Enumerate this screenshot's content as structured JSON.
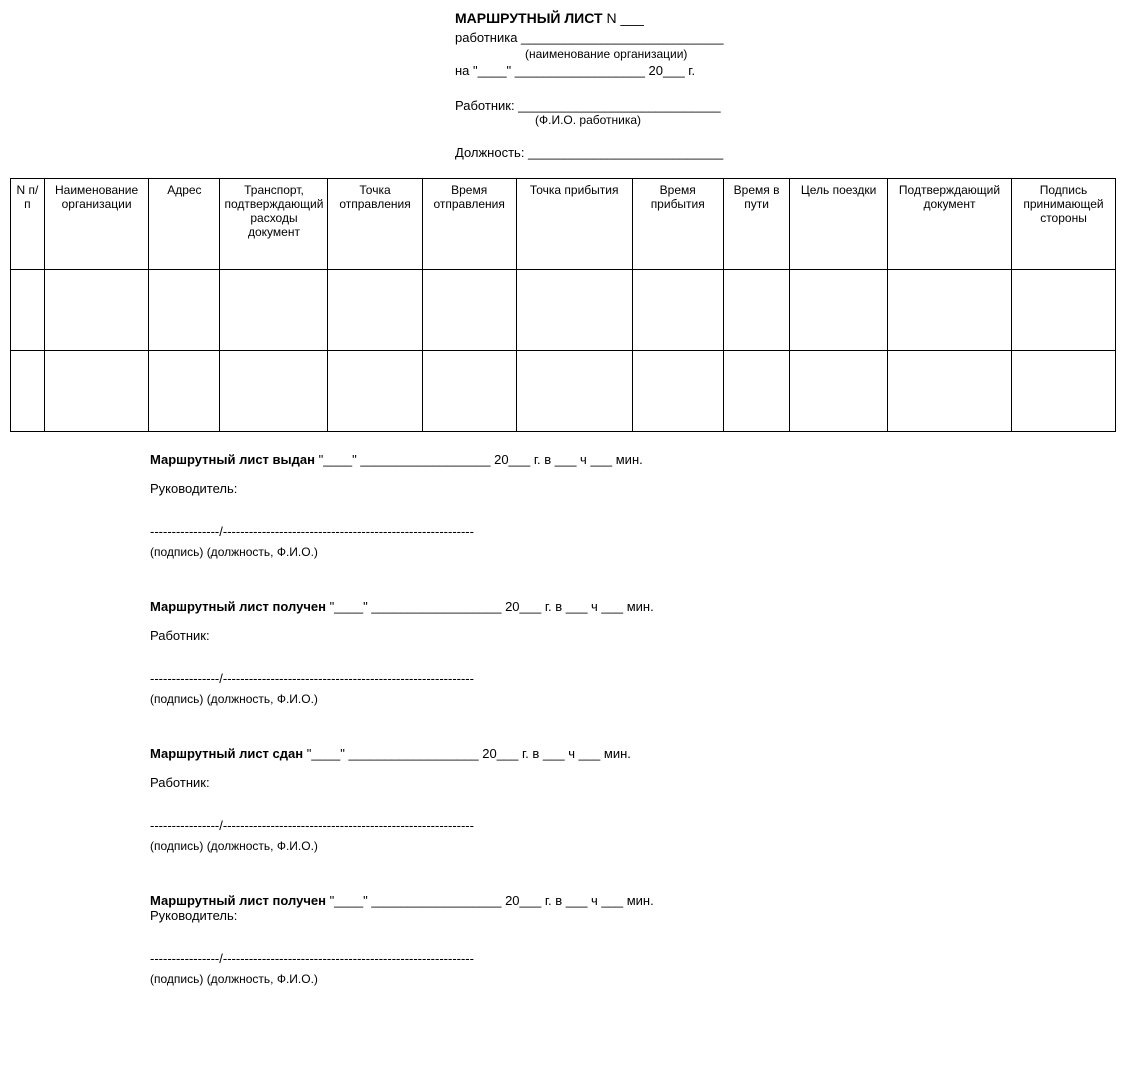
{
  "header": {
    "title_prefix": "МАРШРУТНЫЙ ЛИСТ",
    "title_suffix": " N ___",
    "line_employee": "работника ____________________________",
    "hint_org": "(наименование организации)",
    "line_date": "на \"____\" __________________ 20___ г."
  },
  "field_worker": {
    "label": "Работник: ____________________________",
    "hint": "(Ф.И.О. работника)"
  },
  "field_position": {
    "label": "Должность: ___________________________"
  },
  "table": {
    "headers": [
      "N п/п",
      "Наименование организации",
      "Адрес",
      "Транспорт, подтверждающий расходы документ",
      "Точка отправления",
      "Время отправления",
      "Точка прибытия",
      "Время прибытия",
      "Время в пути",
      "Цель поездки",
      "Подтверждающий документ",
      "Подпись принимающей стороны"
    ]
  },
  "sections": [
    {
      "heading_bold": "Маршрутный лист выдан",
      "heading_rest": " \"____\" __________________ 20___ г. в ___ ч ___ мин.",
      "role": "Руководитель:",
      "sigline": "----------------/----------------------------------------------------------",
      "siglabel": "(подпись)         (должность, Ф.И.О.)"
    },
    {
      "heading_bold": "Маршрутный лист получен",
      "heading_rest": " \"____\" __________________ 20___ г. в ___ ч ___ мин.",
      "role": "Работник:",
      "sigline": " ----------------/----------------------------------------------------------",
      "siglabel": " (подпись)         (должность, Ф.И.О.)"
    },
    {
      "heading_bold": "Маршрутный лист сдан",
      "heading_rest": " \"____\" __________________ 20___ г. в ___ ч ___ мин.",
      "role": "Работник:",
      "sigline": " ----------------/----------------------------------------------------------",
      "siglabel": " (подпись)         (должность, Ф.И.О.)"
    },
    {
      "heading_bold": "Маршрутный лист получен",
      "heading_rest": " \"____\" __________________ 20___ г. в ___ ч ___ мин.",
      "role": "Руководитель:",
      "sigline": " ----------------/----------------------------------------------------------",
      "siglabel": " (подпись)         (должность, Ф.И.О.)"
    }
  ]
}
